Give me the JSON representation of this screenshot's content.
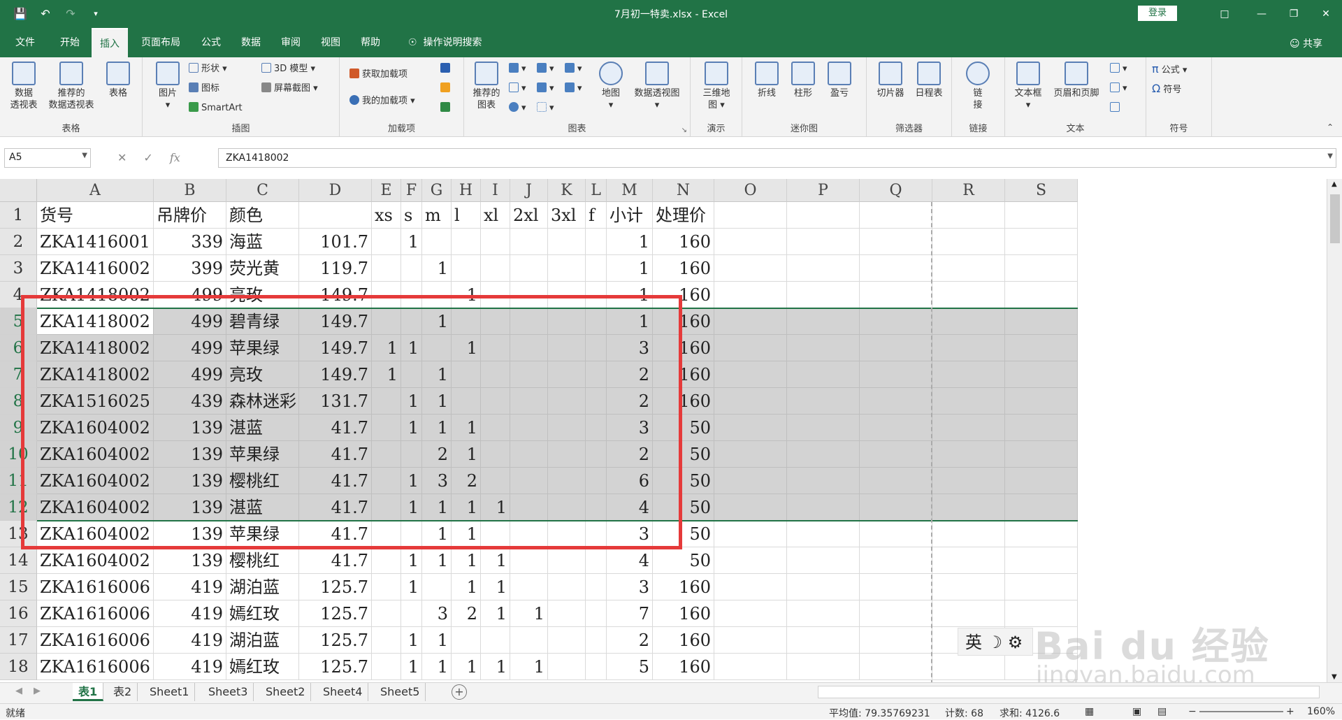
{
  "titlebar": {
    "title": "7月初一特卖.xlsx  -  Excel",
    "login": "登录"
  },
  "tabs": [
    "文件",
    "开始",
    "插入",
    "页面布局",
    "公式",
    "数据",
    "审阅",
    "视图",
    "帮助"
  ],
  "active_tab": "插入",
  "search_label": "操作说明搜索",
  "share": "共享",
  "ribbon": {
    "groups": [
      "表格",
      "插图",
      "加载项",
      "图表",
      "演示",
      "迷你图",
      "筛选器",
      "链接",
      "文本",
      "符号"
    ],
    "pivot": "数据\n透视表",
    "recommended_pivot": "推荐的\n数据透视表",
    "table": "表格",
    "picture": "图片",
    "shapes": "形状",
    "icons": "图标",
    "smartart": "SmartArt",
    "model3d": "3D 模型",
    "screenshot": "屏幕截图",
    "get_addins": "获取加载项",
    "my_addins": "我的加载项",
    "rec_charts": "推荐的\n图表",
    "map": "地图",
    "pivot_chart": "数据透视图",
    "map3d": "三维地\n图",
    "line": "折线",
    "column": "柱形",
    "winloss": "盈亏",
    "slicer": "切片器",
    "timeline": "日程表",
    "link": "链\n接",
    "textbox": "文本框",
    "header_footer": "页眉和页脚",
    "equation": "公式",
    "symbol": "符号"
  },
  "formula_bar": {
    "namebox": "A5",
    "formula": "ZKA1418002"
  },
  "columns": [
    "A",
    "B",
    "C",
    "D",
    "E",
    "F",
    "G",
    "H",
    "I",
    "J",
    "K",
    "L",
    "M",
    "N",
    "O",
    "P",
    "Q",
    "R",
    "S"
  ],
  "rows": [
    [
      "货号",
      "吊牌价",
      "颜色",
      "",
      "xs",
      "s",
      "m",
      "l",
      "xl",
      "2xl",
      "3xl",
      "f",
      "小计",
      "处理价"
    ],
    [
      "ZKA1416001",
      "339",
      "海蓝",
      "101.7",
      "",
      "1",
      "",
      "",
      "",
      "",
      "",
      "",
      "1",
      "160"
    ],
    [
      "ZKA1416002",
      "399",
      "荧光黄",
      "119.7",
      "",
      "",
      "1",
      "",
      "",
      "",
      "",
      "",
      "1",
      "160"
    ],
    [
      "ZKA1418002",
      "499",
      "亮玫",
      "149.7",
      "",
      "",
      "",
      "1",
      "",
      "",
      "",
      "",
      "1",
      "160"
    ],
    [
      "ZKA1418002",
      "499",
      "碧青绿",
      "149.7",
      "",
      "",
      "1",
      "",
      "",
      "",
      "",
      "",
      "1",
      "160"
    ],
    [
      "ZKA1418002",
      "499",
      "苹果绿",
      "149.7",
      "1",
      "1",
      "",
      "1",
      "",
      "",
      "",
      "",
      "3",
      "160"
    ],
    [
      "ZKA1418002",
      "499",
      "亮玫",
      "149.7",
      "1",
      "",
      "1",
      "",
      "",
      "",
      "",
      "",
      "2",
      "160"
    ],
    [
      "ZKA1516025",
      "439",
      "森林迷彩",
      "131.7",
      "",
      "1",
      "1",
      "",
      "",
      "",
      "",
      "",
      "2",
      "160"
    ],
    [
      "ZKA1604002",
      "139",
      "湛蓝",
      "41.7",
      "",
      "1",
      "1",
      "1",
      "",
      "",
      "",
      "",
      "3",
      "50"
    ],
    [
      "ZKA1604002",
      "139",
      "苹果绿",
      "41.7",
      "",
      "",
      "2",
      "1",
      "",
      "",
      "",
      "",
      "2",
      "50"
    ],
    [
      "ZKA1604002",
      "139",
      "樱桃红",
      "41.7",
      "",
      "1",
      "3",
      "2",
      "",
      "",
      "",
      "",
      "6",
      "50"
    ],
    [
      "ZKA1604002",
      "139",
      "湛蓝",
      "41.7",
      "",
      "1",
      "1",
      "1",
      "1",
      "",
      "",
      "",
      "4",
      "50"
    ],
    [
      "ZKA1604002",
      "139",
      "苹果绿",
      "41.7",
      "",
      "",
      "1",
      "1",
      "",
      "",
      "",
      "",
      "3",
      "50"
    ],
    [
      "ZKA1604002",
      "139",
      "樱桃红",
      "41.7",
      "",
      "1",
      "1",
      "1",
      "1",
      "",
      "",
      "",
      "4",
      "50"
    ],
    [
      "ZKA1616006",
      "419",
      "湖泊蓝",
      "125.7",
      "",
      "1",
      "",
      "1",
      "1",
      "",
      "",
      "",
      "3",
      "160"
    ],
    [
      "ZKA1616006",
      "419",
      "嫣红玫",
      "125.7",
      "",
      "",
      "3",
      "2",
      "1",
      "1",
      "",
      "",
      "7",
      "160"
    ],
    [
      "ZKA1616006",
      "419",
      "湖泊蓝",
      "125.7",
      "",
      "1",
      "1",
      "",
      "",
      "",
      "",
      "",
      "2",
      "160"
    ],
    [
      "ZKA1616006",
      "419",
      "嫣红玫",
      "125.7",
      "",
      "1",
      "1",
      "1",
      "1",
      "1",
      "",
      "",
      "5",
      "160"
    ]
  ],
  "selection": {
    "first_row": 5,
    "last_row": 12
  },
  "sheets": [
    "表1",
    "表2",
    "Sheet1",
    "Sheet3",
    "Sheet2",
    "Sheet4",
    "Sheet5"
  ],
  "active_sheet": "表1",
  "status": {
    "ready": "就绪",
    "average": "平均值: 79.35769231",
    "count": "计数: 68",
    "sum": "求和: 4126.6",
    "zoom": "160%"
  },
  "ime": "英",
  "watermark": {
    "brand": "Bai du 经验",
    "url": "jingyan.baidu.com"
  }
}
